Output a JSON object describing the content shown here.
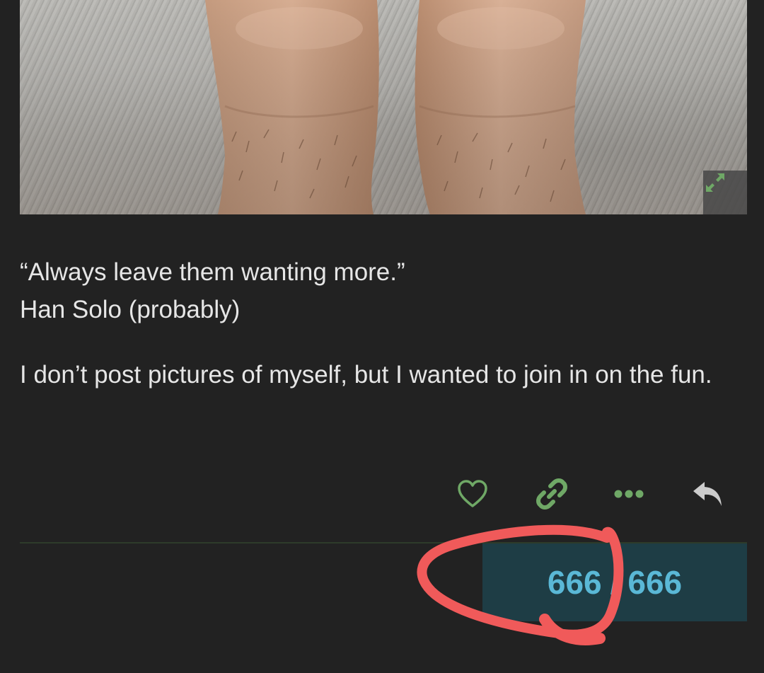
{
  "post": {
    "quote_line": "“Always leave them wanting more.”",
    "quote_author": "Han Solo (probably)",
    "body": "I don’t post pictures of myself, but I wanted to join in on the fun."
  },
  "actions": {
    "like_icon": "heart-icon",
    "share_icon": "link-icon",
    "more_icon": "more-dots-icon",
    "reply_icon": "reply-icon"
  },
  "progress": {
    "current": "666",
    "separator": "/",
    "total": "666"
  },
  "colors": {
    "background": "#222222",
    "text": "#e6e6e6",
    "action_green": "#6fa866",
    "progress_bg": "#1e3d45",
    "progress_text": "#5ab8d6",
    "annotation_red": "#f05a5a"
  }
}
